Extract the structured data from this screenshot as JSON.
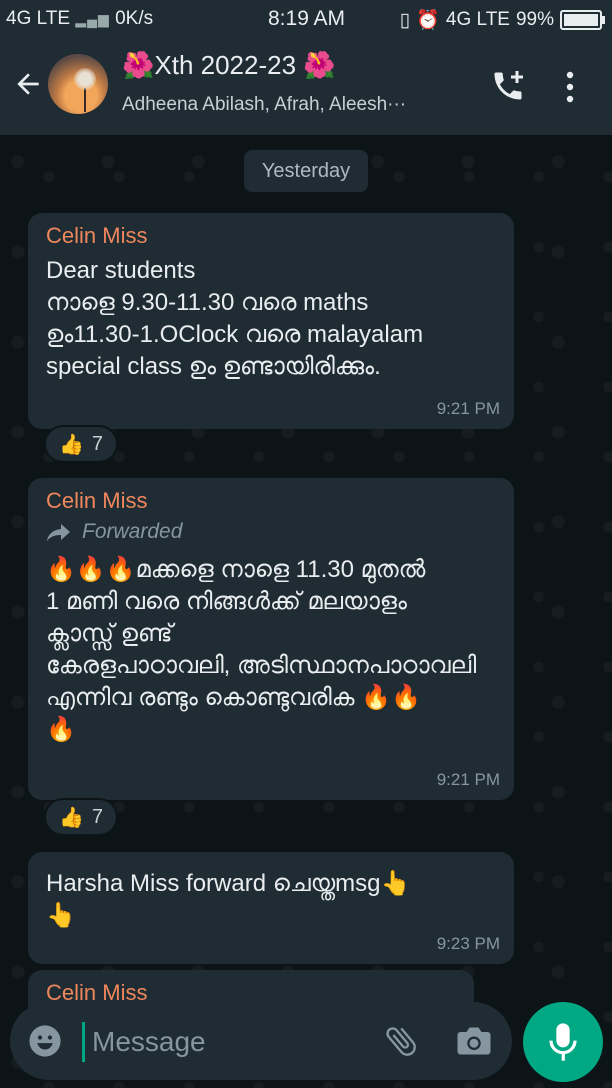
{
  "status_bar": {
    "left": "4G LTE",
    "signal": "▂▄▆",
    "speed": "0K/s",
    "time": "8:19 AM",
    "vibrate": "▯",
    "alarm": "⏰",
    "network": "4G LTE",
    "battery": "99%"
  },
  "header": {
    "title_prefix": "🌺",
    "title": "Xth 2022-23",
    "title_suffix": "🌺",
    "subtitle": "Adheena Abilash, Afrah, Aleesh···"
  },
  "date_chip": "Yesterday",
  "messages": [
    {
      "sender": "Celin Miss",
      "line1": "Dear students",
      "line2": "നാളെ 9.30-11.30 വരെ maths",
      "line3": "ഉം11.30-1.OClock വരെ malayalam",
      "line4": "special class ഉം ഉണ്ടായിരിക്കും.",
      "time": "9:21 PM",
      "reaction_emoji": "👍",
      "reaction_count": "7"
    },
    {
      "sender": "Celin Miss",
      "forwarded": "Forwarded",
      "fire": "🔥🔥🔥",
      "line1": "മക്കളെ  നാളെ 11.30 മുതൽ",
      "line2": "1 മണി വരെ  നിങ്ങൾക്ക് മലയാളം",
      "line3": "ക്ലാസ്സ് ഉണ്ട്",
      "line4": "കേരളപാഠാവലി, അടിസ്ഥാനപാഠാവലി",
      "line5": "എന്നിവ രണ്ടും കൊണ്ടുവരിക",
      "fire_end": "🔥🔥",
      "fire_last": "🔥",
      "time": "9:21 PM",
      "reaction_emoji": "👍",
      "reaction_count": "7"
    },
    {
      "line1": "Harsha Miss forward ചെയ്തmsg👆",
      "line2": "👆",
      "time": "9:23 PM"
    }
  ],
  "partial_sender": "Celin Miss",
  "input": {
    "placeholder": "Message"
  },
  "colors": {
    "background": "#0b141a",
    "bubble": "#1f2c33",
    "accent": "#00a884",
    "sender": "#f0875c"
  }
}
